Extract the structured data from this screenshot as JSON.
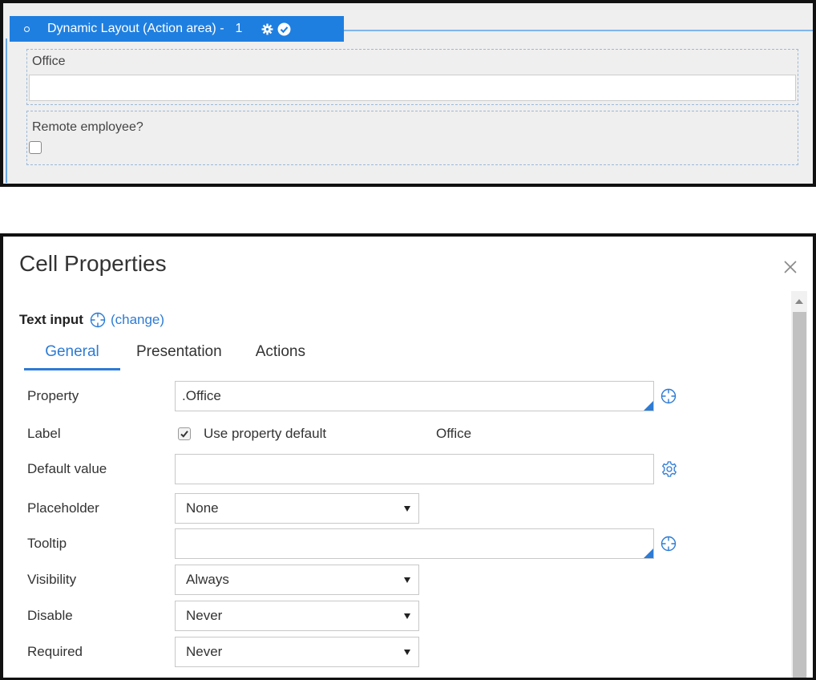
{
  "layout_editor": {
    "header_title": "Dynamic Layout (Action area) -",
    "header_count": "1",
    "office_cell_label": "Office",
    "remote_cell_label": "Remote employee?"
  },
  "dialog": {
    "title": "Cell Properties",
    "control_type": "Text input",
    "change_link": "(change)",
    "tabs": [
      {
        "label": "General",
        "active": true
      },
      {
        "label": "Presentation",
        "active": false
      },
      {
        "label": "Actions",
        "active": false
      }
    ],
    "fields": {
      "property": {
        "label": "Property",
        "value": ".Office"
      },
      "label": {
        "label": "Label",
        "checkbox_text": "Use property default",
        "checked": true,
        "value": "Office"
      },
      "default_value": {
        "label": "Default value",
        "value": ""
      },
      "placeholder": {
        "label": "Placeholder",
        "value": "None"
      },
      "tooltip": {
        "label": "Tooltip",
        "value": ""
      },
      "visibility": {
        "label": "Visibility",
        "value": "Always"
      },
      "disable": {
        "label": "Disable",
        "value": "Never"
      },
      "required": {
        "label": "Required",
        "value": "Never"
      }
    }
  },
  "colors": {
    "accent": "#2d7bd4",
    "header_bg": "#1f7fe0",
    "cell_border": "#9bb9d8"
  },
  "icons": [
    "gear-icon",
    "check-circle-icon",
    "crosshair-icon",
    "settings-gear-icon",
    "close-icon"
  ]
}
